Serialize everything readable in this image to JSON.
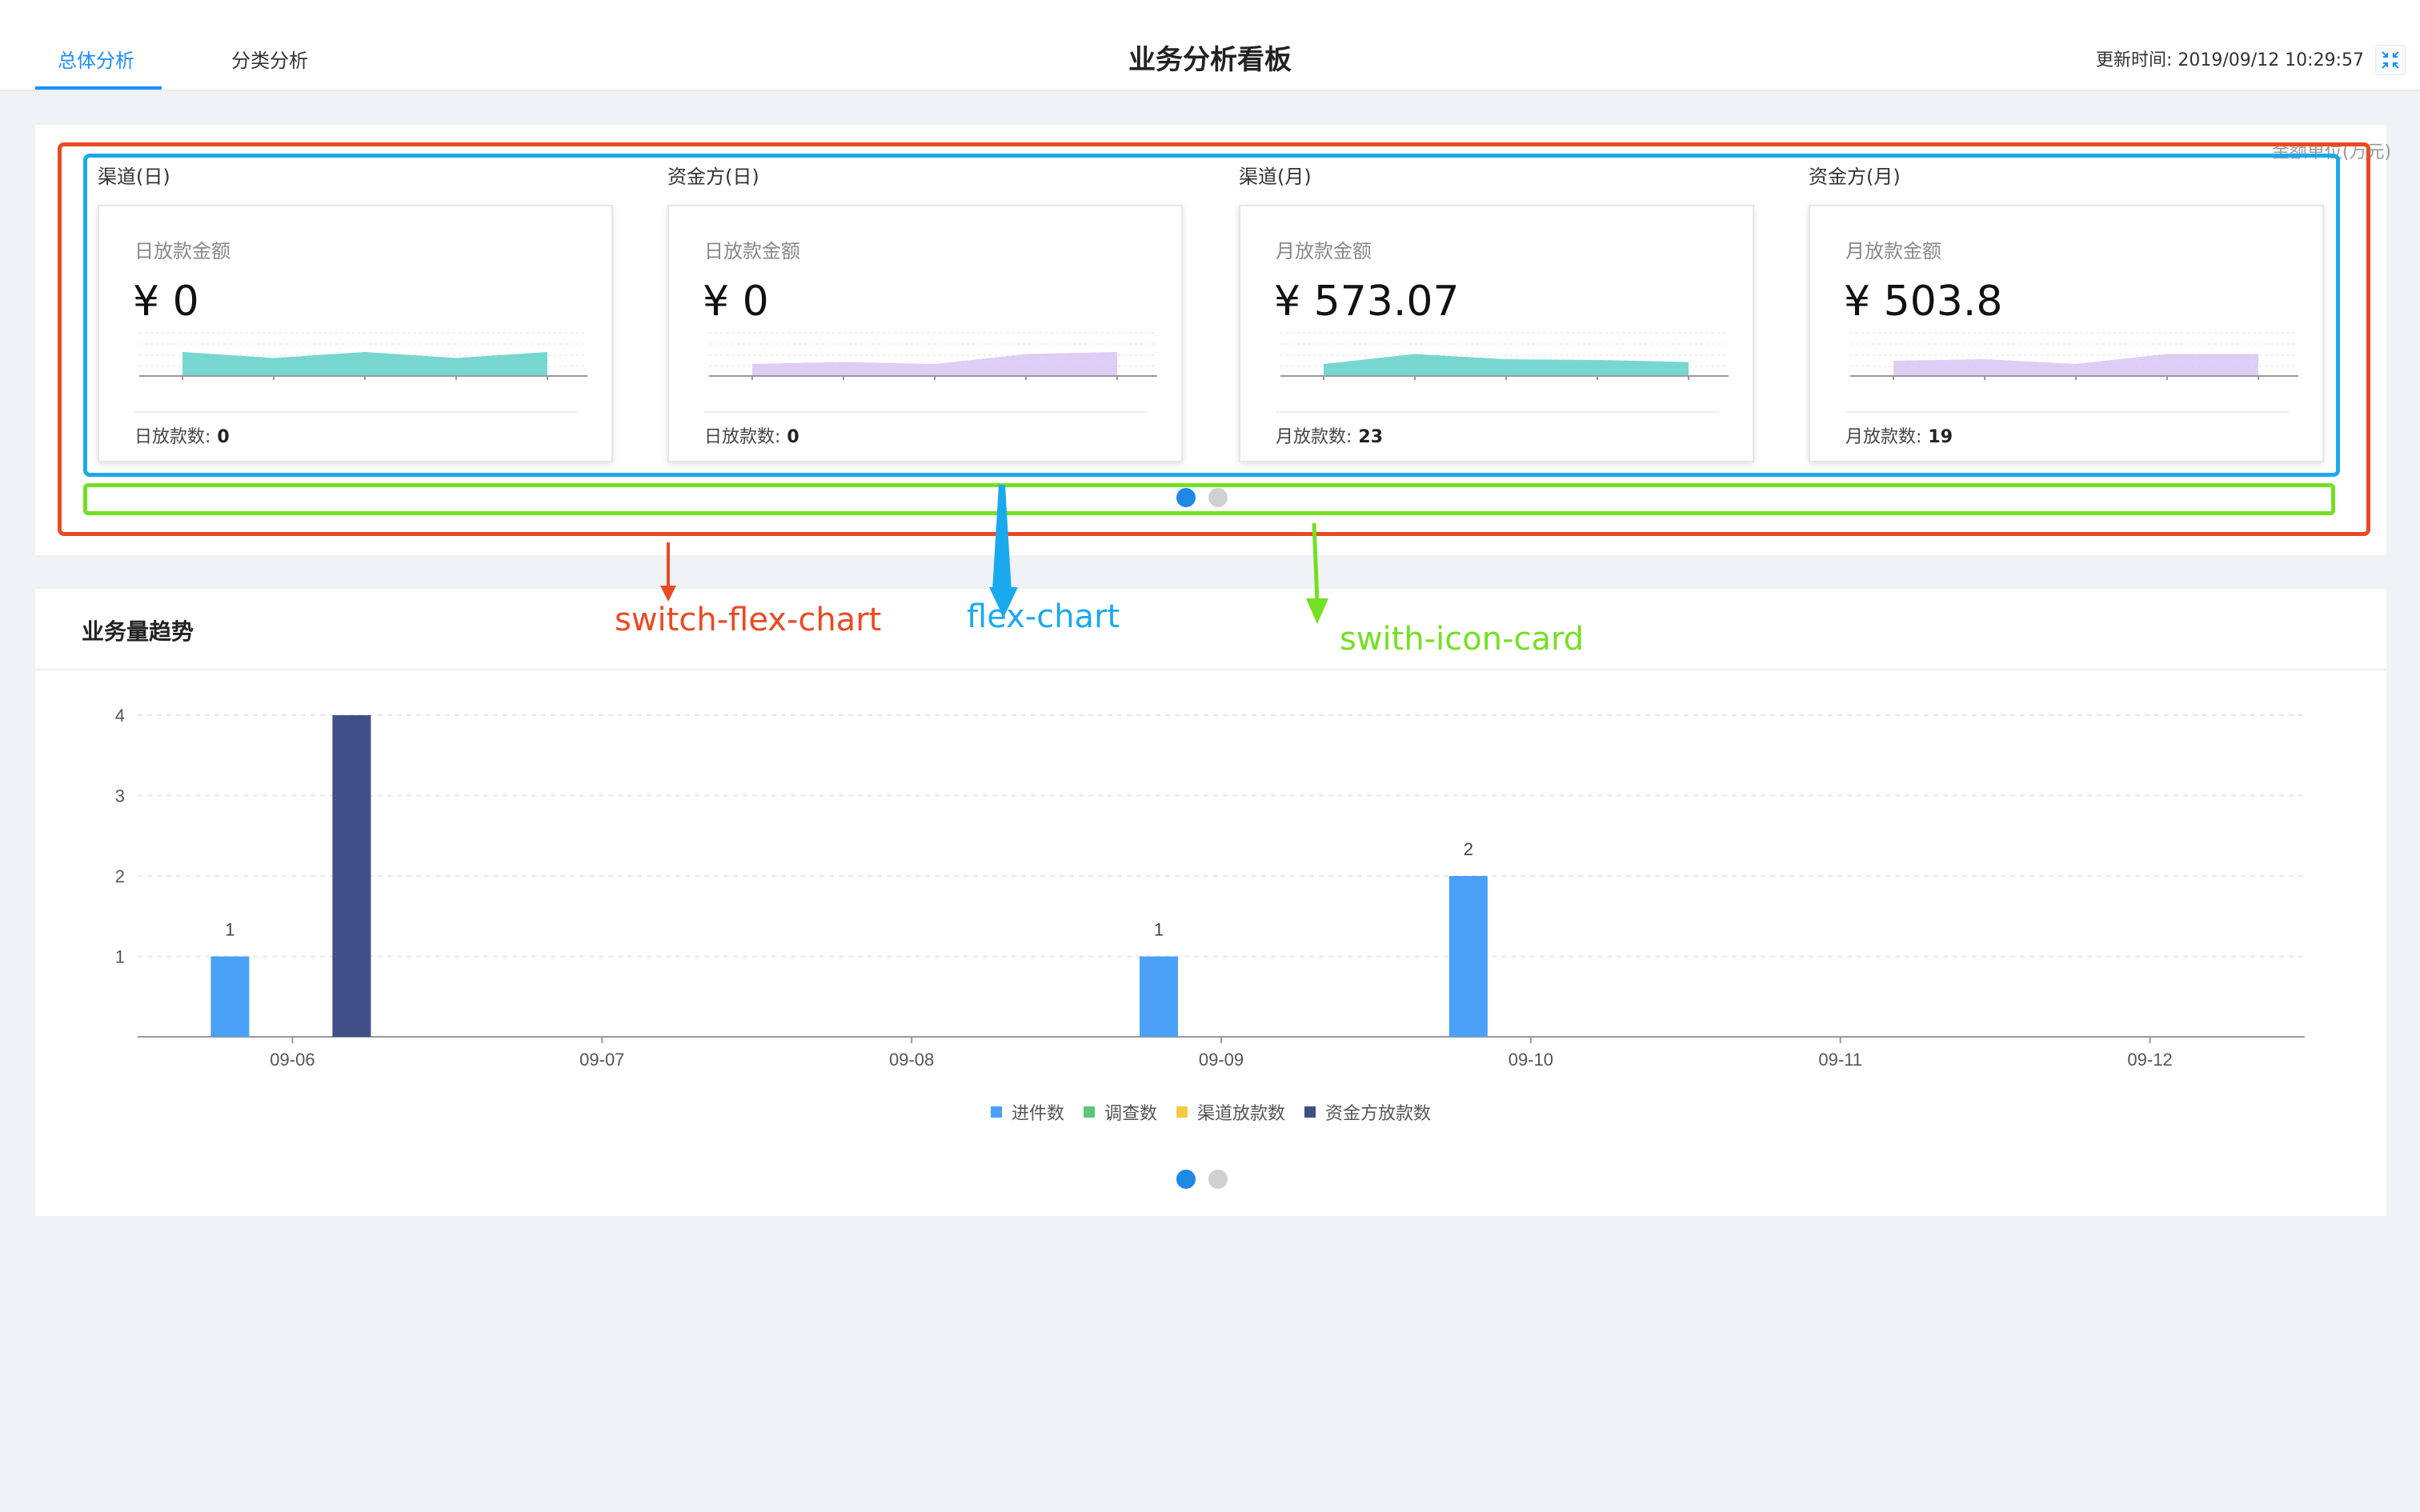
{
  "header": {
    "tabs": [
      {
        "label": "总体分析",
        "active": true
      },
      {
        "label": "分类分析",
        "active": false
      }
    ],
    "title": "业务分析看板",
    "update_time": "更新时间: 2019/09/12 10:29:57",
    "fullscreen_icon": "compress-icon"
  },
  "summary_panel": {
    "unit_label": "金额单位(万元)",
    "groups": [
      {
        "title": "渠道(日)",
        "amount_label": "日放款金额",
        "amount": "¥ 0",
        "count_label": "日放款数:",
        "count": "0",
        "color": "#5fd0c8",
        "trend": [
          0.6,
          0.45,
          0.6,
          0.45,
          0.6
        ]
      },
      {
        "title": "资金方(日)",
        "amount_label": "日放款金额",
        "amount": "¥ 0",
        "count_label": "日放款数:",
        "count": "0",
        "color": "#d8c4f2",
        "trend": [
          0.3,
          0.35,
          0.3,
          0.55,
          0.6
        ]
      },
      {
        "title": "渠道(月)",
        "amount_label": "月放款金额",
        "amount": "¥ 573.07",
        "count_label": "月放款数:",
        "count": "23",
        "color": "#5fd0c8",
        "trend": [
          0.3,
          0.55,
          0.42,
          0.4,
          0.35
        ]
      },
      {
        "title": "资金方(月)",
        "amount_label": "月放款金额",
        "amount": "¥ 503.8",
        "count_label": "月放款数:",
        "count": "19",
        "color": "#d8c4f2",
        "trend": [
          0.38,
          0.42,
          0.3,
          0.55,
          0.55
        ]
      }
    ],
    "pager": {
      "count": 2,
      "active": 0
    }
  },
  "annotations": {
    "switch_flex_chart": "switch-flex-chart",
    "flex_chart": "flex-chart",
    "swith_icon_card": "swith-icon-card"
  },
  "trend_panel": {
    "title": "业务量趋势",
    "pager": {
      "count": 2,
      "active": 0
    }
  },
  "chart_data": {
    "type": "bar",
    "categories": [
      "09-06",
      "09-07",
      "09-08",
      "09-09",
      "09-10",
      "09-11",
      "09-12"
    ],
    "ylim": [
      0,
      4
    ],
    "yticks": [
      1,
      2,
      3,
      4
    ],
    "grid": true,
    "legend_position": "bottom",
    "series": [
      {
        "name": "进件数",
        "color": "#4aa0f7",
        "values": [
          1,
          0,
          0,
          1,
          2,
          0,
          0
        ]
      },
      {
        "name": "调查数",
        "color": "#5cc77a",
        "values": [
          0,
          0,
          0,
          0,
          0,
          0,
          0
        ]
      },
      {
        "name": "渠道放款数",
        "color": "#f7c842",
        "values": [
          0,
          0,
          0,
          0,
          0,
          0,
          0
        ]
      },
      {
        "name": "资金方放款数",
        "color": "#3f5088",
        "values": [
          4,
          0,
          0,
          0,
          0,
          0,
          0
        ]
      }
    ]
  }
}
